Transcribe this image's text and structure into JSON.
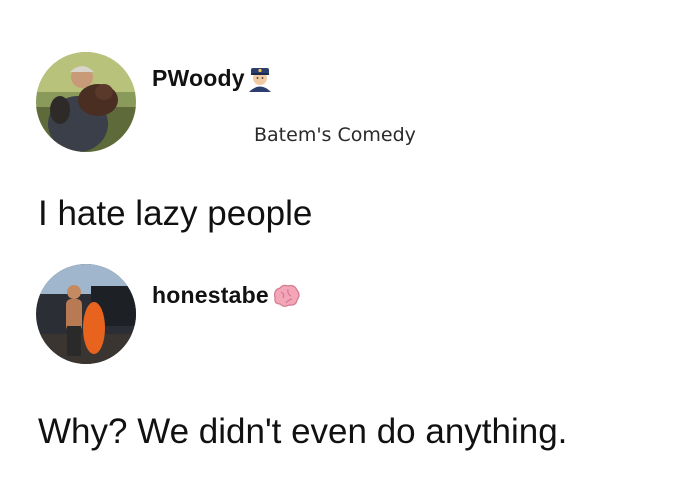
{
  "post": {
    "author": {
      "username": "PWoody",
      "avatar_icon": "profile-photo-person-with-dog",
      "badge_icon": "police-officer-emoji"
    },
    "watermark": "Batem's Comedy",
    "text": "I hate lazy people"
  },
  "reply": {
    "author": {
      "username": "honestabe",
      "avatar_icon": "profile-photo-person-with-kayak",
      "badge_icon": "brain-emoji"
    },
    "text": "Why? We didn't even do anything."
  },
  "colors": {
    "background": "#ffffff",
    "text": "#111111",
    "brain": "#f2a6b8",
    "kayak": "#e8641e"
  }
}
